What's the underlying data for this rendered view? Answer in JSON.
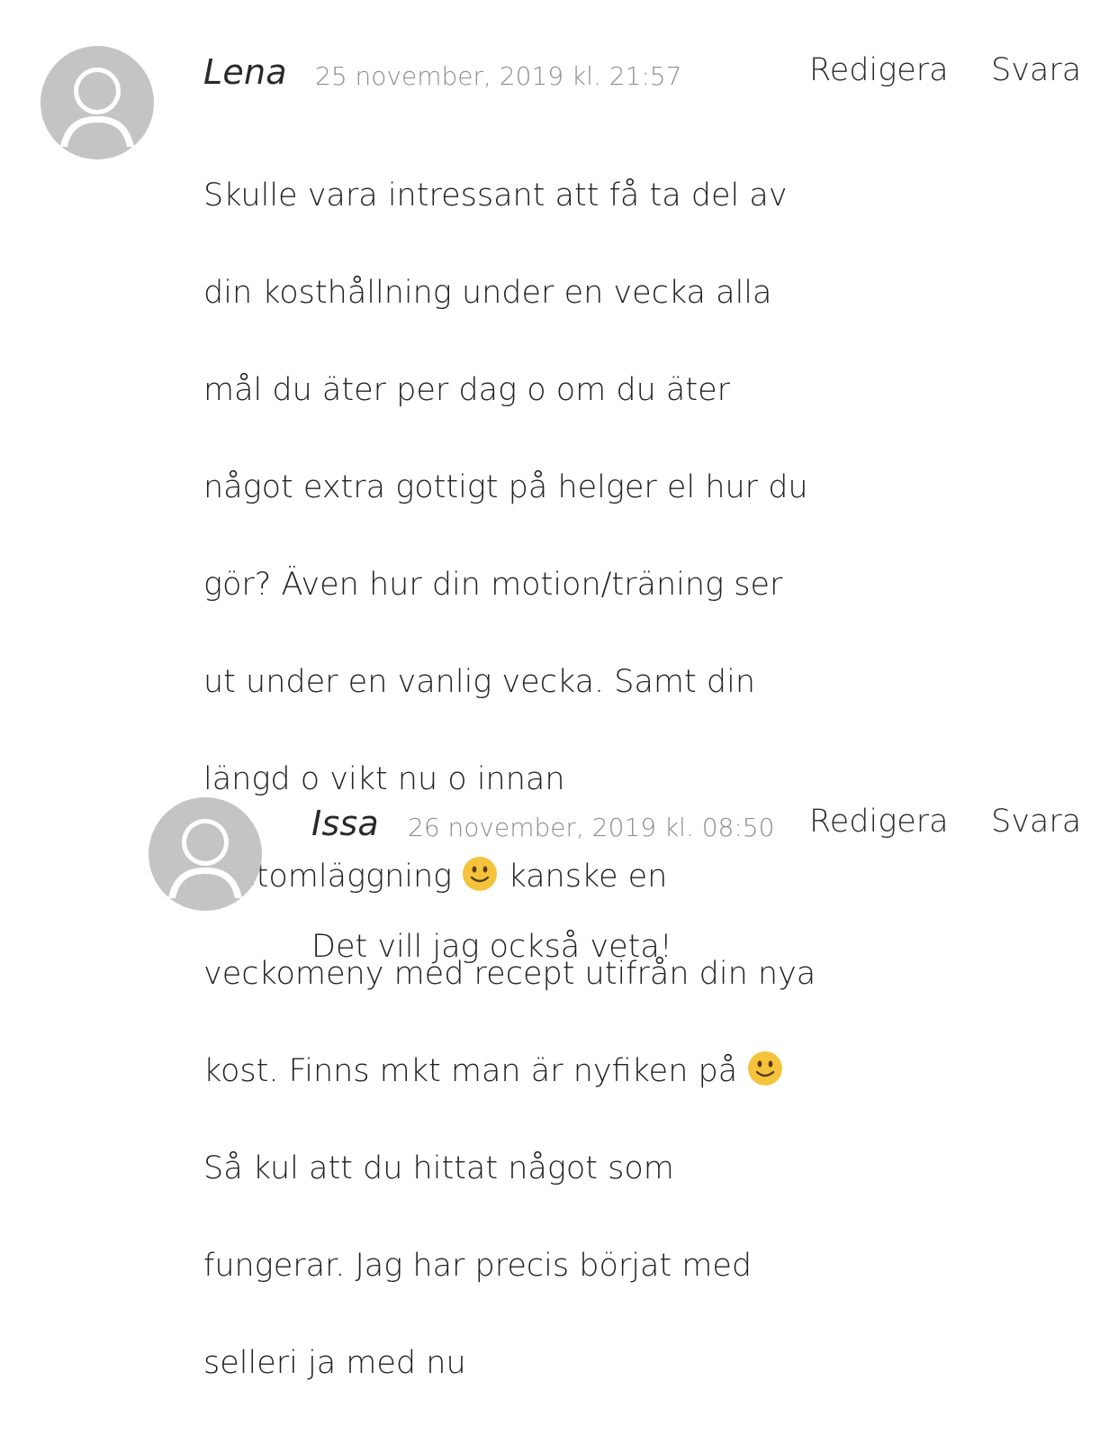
{
  "comments": [
    {
      "author": "Lena",
      "date": "25 november, 2019 kl. 21:57",
      "edit_label": "Redigera",
      "reply_label": "Svara",
      "lines": [
        "Skulle vara intressant att få ta del av",
        "din kosthållning under en vecka alla",
        "mål du äter per dag o om du äter",
        "något extra gottigt på helger el hur du",
        "gör? Även hur din motion/träning ser",
        "ut under en vanlig vecka. Samt din",
        "längd o vikt nu o innan"
      ],
      "line_emoji_1_before": "kostomläggning",
      "line_emoji_1_after": "kanske en",
      "line_8": "veckomeny med recept utifrån din nya",
      "line_emoji_2_before": "kost. Finns mkt man är nyfiken på",
      "lines_end": [
        "Så kul att du hittat något som",
        "fungerar. Jag har precis börjat med",
        "selleri ja med nu"
      ]
    },
    {
      "author": "Issa",
      "date": "26 november, 2019 kl. 08:50",
      "edit_label": "Redigera",
      "reply_label": "Svara",
      "text": "Det vill jag också veta!"
    }
  ],
  "icons": {
    "avatar": "default-avatar-icon",
    "emoji": "slightly-smiling-face-icon"
  },
  "colors": {
    "avatar_bg": "#c4c4c4",
    "avatar_fg": "#ffffff",
    "date": "#8e8e8e",
    "text": "#222222",
    "emoji": "#f5c33b"
  }
}
